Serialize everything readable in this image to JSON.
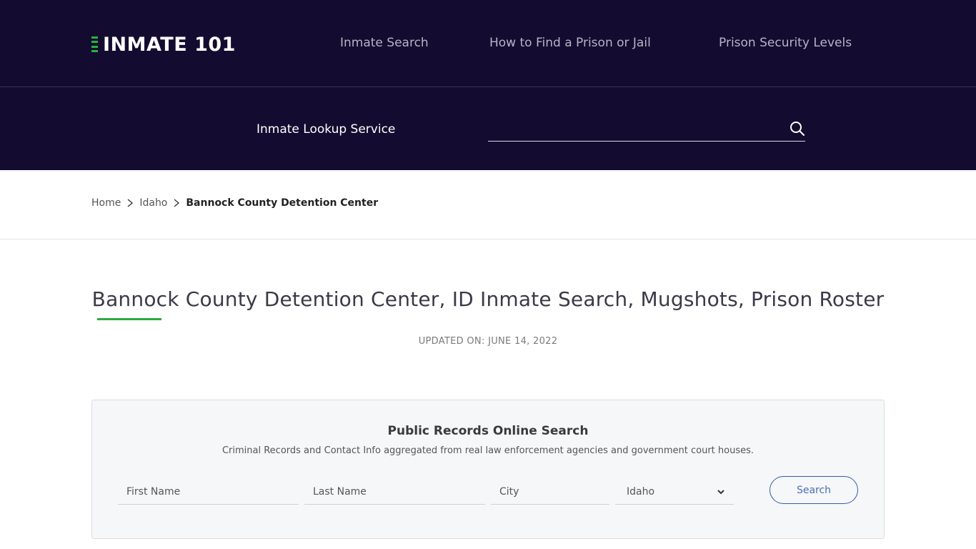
{
  "header": {
    "logo_text": "INMATE 101",
    "nav": [
      {
        "label": "Inmate Search"
      },
      {
        "label": "How to Find a Prison or Jail"
      },
      {
        "label": "Prison Security Levels"
      }
    ],
    "lookup_label": "Inmate Lookup Service",
    "lookup_placeholder": ""
  },
  "breadcrumb": {
    "items": [
      {
        "label": "Home"
      },
      {
        "label": "Idaho"
      }
    ],
    "current": "Bannock County Detention Center"
  },
  "main": {
    "title": "Bannock County Detention Center, ID Inmate Search, Mugshots, Prison Roster",
    "updated": "UPDATED ON: JUNE 14, 2022"
  },
  "search_card": {
    "title": "Public Records Online Search",
    "subtitle": "Criminal Records and Contact Info aggregated from real law enforcement agencies and government court houses.",
    "first_name_placeholder": "First Name",
    "last_name_placeholder": "Last Name",
    "city_placeholder": "City",
    "state_selected": "Idaho",
    "search_label": "Search"
  },
  "colors": {
    "header_bg": "#140c30",
    "accent_green": "#2eac3f",
    "button_blue": "#2f5fa8"
  }
}
